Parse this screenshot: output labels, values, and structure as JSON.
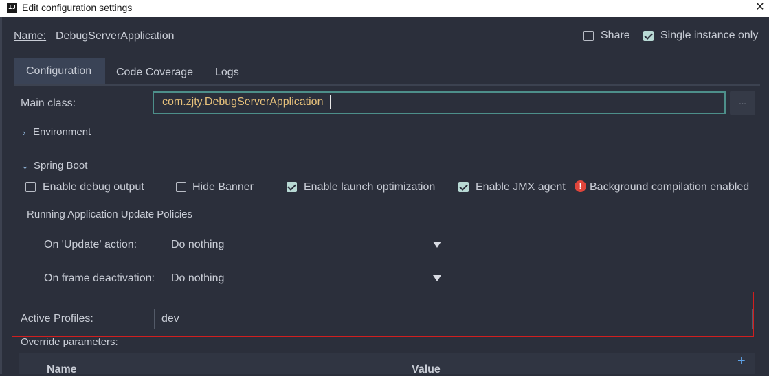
{
  "window": {
    "title": "Edit configuration settings",
    "app_icon": "IJ",
    "close_glyph": "✕"
  },
  "name_row": {
    "label": "Name:",
    "value": "DebugServerApplication",
    "share": {
      "label": "Share",
      "checked": false
    },
    "single_instance": {
      "label": "Single instance only",
      "checked": true
    }
  },
  "tabs": [
    {
      "label": "Configuration",
      "active": true
    },
    {
      "label": "Code Coverage",
      "active": false
    },
    {
      "label": "Logs",
      "active": false
    }
  ],
  "main_class": {
    "label": "Main class:",
    "value": "com.zjty.DebugServerApplication",
    "browse_label": "..."
  },
  "environment": {
    "label": "Environment",
    "expanded": false
  },
  "spring_boot": {
    "label": "Spring Boot",
    "expanded": true,
    "options": [
      {
        "label": "Enable debug output",
        "checked": false
      },
      {
        "label": "Hide Banner",
        "checked": false
      },
      {
        "label": "Enable launch optimization",
        "checked": true
      },
      {
        "label": "Enable JMX agent",
        "checked": true
      }
    ],
    "warning": "Background compilation enabled"
  },
  "update_policies": {
    "heading": "Running Application Update Policies",
    "on_update": {
      "label": "On 'Update' action:",
      "value": "Do nothing"
    },
    "on_frame": {
      "label": "On frame deactivation:",
      "value": "Do nothing"
    }
  },
  "active_profiles": {
    "label": "Active Profiles:",
    "value": "dev"
  },
  "override": {
    "label": "Override parameters:",
    "columns": [
      "Name",
      "Value"
    ],
    "add_glyph": "+"
  },
  "colors": {
    "accent": "#4d8f8a",
    "highlight_border": "#d11f1f",
    "value_text": "#e5c07b"
  },
  "icons": [
    "close-icon",
    "chevron-right-icon",
    "chevron-down-icon",
    "warning-icon",
    "add-icon",
    "dropdown-arrow-icon"
  ]
}
